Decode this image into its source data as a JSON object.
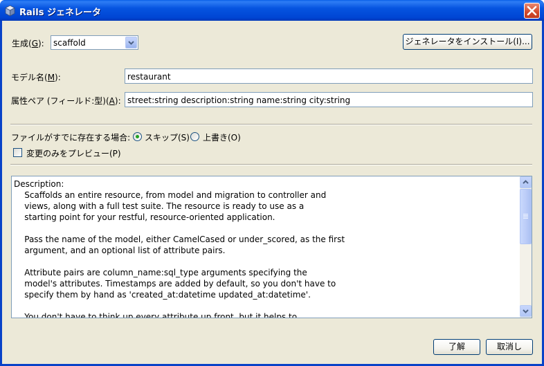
{
  "window": {
    "title": "Rails ジェネレータ"
  },
  "form": {
    "generate_label": "生成(",
    "generate_mnemonic": "G",
    "generate_suffix": "):",
    "generate_value": "scaffold",
    "install_button": "ジェネレータをインストール(I)...",
    "model_label": "モデル名(",
    "model_mnemonic": "M",
    "model_suffix": "):",
    "model_value": "restaurant",
    "attrs_label": "属性ペア (フィールド:型)(",
    "attrs_mnemonic": "A",
    "attrs_suffix": "):",
    "attrs_value": "street:string description:string name:string city:string",
    "exists_label": "ファイルがすでに存在する場合:",
    "skip_label": "スキップ(S)",
    "overwrite_label": "上書き(O)",
    "preview_label": "変更のみをプレビュー(P)"
  },
  "description": {
    "text": "Description:\n    Scaffolds an entire resource, from model and migration to controller and\n    views, along with a full test suite. The resource is ready to use as a\n    starting point for your restful, resource-oriented application.\n\n    Pass the name of the model, either CamelCased or under_scored, as the first\n    argument, and an optional list of attribute pairs.\n\n    Attribute pairs are column_name:sql_type arguments specifying the\n    model's attributes. Timestamps are added by default, so you don't have to\n    specify them by hand as 'created_at:datetime updated_at:datetime'.\n\n    You don't have to think up every attribute up front, but it helps to"
  },
  "buttons": {
    "ok": "了解",
    "cancel": "取消し"
  },
  "colors": {
    "titlebar": "#0054e3",
    "face": "#ece9d8",
    "radio_dot": "#21a121"
  }
}
